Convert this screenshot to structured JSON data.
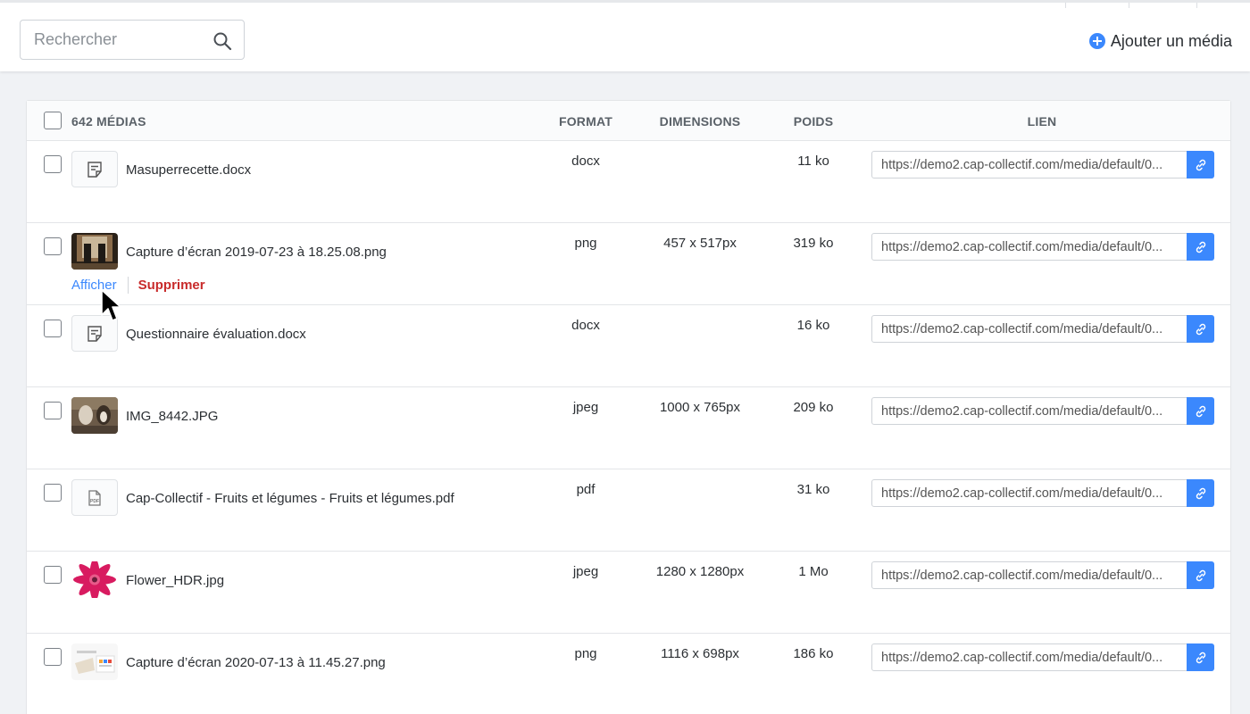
{
  "toolbar": {
    "search_placeholder": "Rechercher",
    "add_media_label": "Ajouter un média",
    "accent": "#3b88fd"
  },
  "table": {
    "count_label": "642 MÉDIAS",
    "columns": {
      "format": "FORMAT",
      "dimensions": "DIMENSIONS",
      "poids": "POIDS",
      "lien": "LIEN"
    },
    "row_actions": {
      "show": "Afficher",
      "delete": "Supprimer"
    },
    "rows": [
      {
        "name": "Masuperrecette.docx",
        "format": "docx",
        "dimensions": "",
        "size": "11 ko",
        "link": "https://demo2.cap-collectif.com/media/default/0...",
        "thumb": "doc-icon"
      },
      {
        "name": "Capture d’écran 2019-07-23 à 18.25.08.png",
        "format": "png",
        "dimensions": "457 x 517px",
        "size": "319 ko",
        "link": "https://demo2.cap-collectif.com/media/default/0...",
        "thumb": "photo-dark"
      },
      {
        "name": "Questionnaire évaluation.docx",
        "format": "docx",
        "dimensions": "",
        "size": "16 ko",
        "link": "https://demo2.cap-collectif.com/media/default/0...",
        "thumb": "doc-icon"
      },
      {
        "name": "IMG_8442.JPG",
        "format": "jpeg",
        "dimensions": "1000 x 765px",
        "size": "209 ko",
        "link": "https://demo2.cap-collectif.com/media/default/0...",
        "thumb": "photo-goats"
      },
      {
        "name": "Cap-Collectif - Fruits et légumes - Fruits et légumes.pdf",
        "format": "pdf",
        "dimensions": "",
        "size": "31 ko",
        "link": "https://demo2.cap-collectif.com/media/default/0...",
        "thumb": "pdf-icon"
      },
      {
        "name": "Flower_HDR.jpg",
        "format": "jpeg",
        "dimensions": "1280 x 1280px",
        "size": "1 Mo",
        "link": "https://demo2.cap-collectif.com/media/default/0...",
        "thumb": "photo-flower"
      },
      {
        "name": "Capture d’écran 2020-07-13 à 11.45.27.png",
        "format": "png",
        "dimensions": "1116 x 698px",
        "size": "186 ko",
        "link": "https://demo2.cap-collectif.com/media/default/0...",
        "thumb": "photo-screenshot"
      }
    ]
  }
}
